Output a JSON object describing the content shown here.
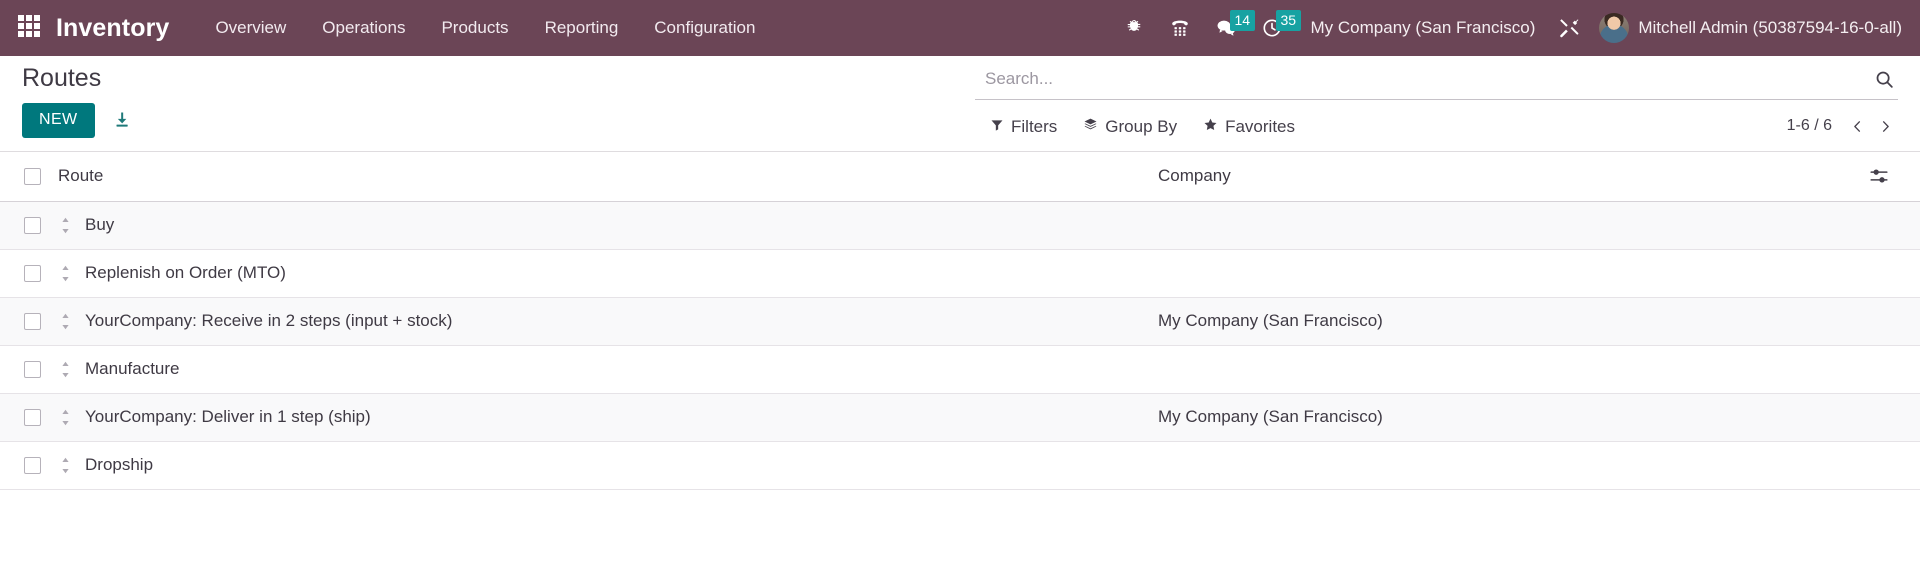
{
  "navbar": {
    "apps_icon": "apps-grid-icon",
    "brand": "Inventory",
    "menu": [
      {
        "label": "Overview"
      },
      {
        "label": "Operations"
      },
      {
        "label": "Products"
      },
      {
        "label": "Reporting"
      },
      {
        "label": "Configuration"
      }
    ],
    "system_icons": [
      {
        "name": "bug-icon",
        "badge": null
      },
      {
        "name": "phone-dialpad-icon",
        "badge": null
      },
      {
        "name": "messages-icon",
        "badge": "14"
      },
      {
        "name": "activities-clock-icon",
        "badge": "35"
      }
    ],
    "company": "My Company (San Francisco)",
    "tools_icon": "tools-icon",
    "user": "Mitchell Admin (50387594-16-0-all)",
    "badge_color": "#17a2a2",
    "bar_color": "#6b4556"
  },
  "control_panel": {
    "title": "Routes",
    "new_label": "NEW",
    "download_icon": "download-icon",
    "search": {
      "value": "",
      "placeholder": "Search...",
      "icon": "search-icon"
    },
    "filters": [
      {
        "label": "Filters",
        "icon": "funnel-icon"
      },
      {
        "label": "Group By",
        "icon": "layers-icon"
      },
      {
        "label": "Favorites",
        "icon": "star-icon"
      }
    ],
    "pager": {
      "count": "1-6 / 6",
      "prev_icon": "chevron-left-icon",
      "next_icon": "chevron-right-icon"
    },
    "new_button_color": "#00787d"
  },
  "list": {
    "columns": [
      {
        "key": "route",
        "label": "Route"
      },
      {
        "key": "company",
        "label": "Company"
      }
    ],
    "optional_columns_icon": "sliders-icon",
    "rows": [
      {
        "route": "Buy",
        "company": ""
      },
      {
        "route": "Replenish on Order (MTO)",
        "company": ""
      },
      {
        "route": "YourCompany: Receive in 2 steps (input + stock)",
        "company": "My Company (San Francisco)"
      },
      {
        "route": "Manufacture",
        "company": ""
      },
      {
        "route": "YourCompany: Deliver in 1 step (ship)",
        "company": "My Company (San Francisco)"
      },
      {
        "route": "Dropship",
        "company": ""
      }
    ]
  }
}
